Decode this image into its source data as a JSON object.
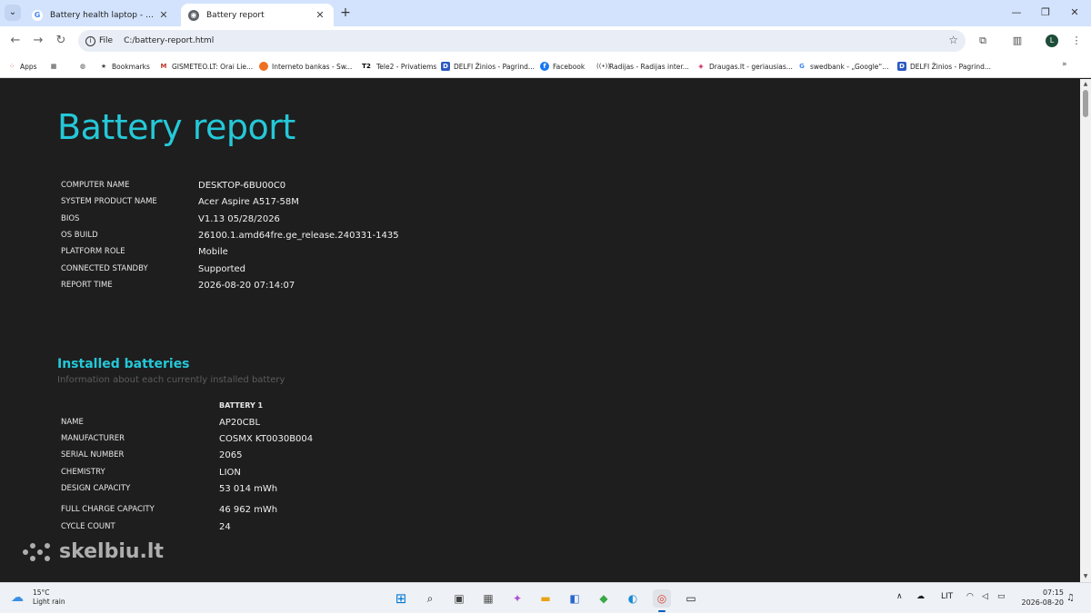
{
  "browser": {
    "tabs": [
      {
        "title": "Battery health laptop - „Google“ p",
        "favicon": "google-icon"
      },
      {
        "title": "Battery report",
        "favicon": "globe-icon"
      }
    ],
    "address": {
      "chip": "File",
      "url": "C:/battery-report.html"
    },
    "profile_initial": "L",
    "bookmarks": [
      {
        "label": "Apps",
        "icon": "apps-grid-icon"
      },
      {
        "label": "",
        "icon": "tab-groups-icon"
      },
      {
        "label": "",
        "icon": "globe-icon"
      },
      {
        "label": "Bookmarks",
        "icon": "star-icon"
      },
      {
        "label": "GISMETEO.LT: Orai Lie...",
        "icon": "gismeteo-icon"
      },
      {
        "label": "Interneto bankas - Sw...",
        "icon": "swedbank-icon"
      },
      {
        "label": "Tele2 - Privatiems",
        "icon": "tele2-icon"
      },
      {
        "label": "DELFI Žinios - Pagrind...",
        "icon": "delfi-icon"
      },
      {
        "label": "Facebook",
        "icon": "facebook-icon"
      },
      {
        "label": "Radijas - Radijas inter...",
        "icon": "radio-icon"
      },
      {
        "label": "Draugas.lt - geriausias...",
        "icon": "draugas-icon"
      },
      {
        "label": "swedbank - „Google“...",
        "icon": "google-icon"
      },
      {
        "label": "DELFI Žinios - Pagrind...",
        "icon": "delfi-icon"
      }
    ]
  },
  "report": {
    "title": "Battery report",
    "system_info": [
      {
        "label": "COMPUTER NAME",
        "value": "DESKTOP-6BU00C0"
      },
      {
        "label": "SYSTEM PRODUCT NAME",
        "value": "Acer Aspire A517-58M"
      },
      {
        "label": "BIOS",
        "value": "V1.13 05/28/2026"
      },
      {
        "label": "OS BUILD",
        "value": "26100.1.amd64fre.ge_release.240331-1435"
      },
      {
        "label": "PLATFORM ROLE",
        "value": "Mobile"
      },
      {
        "label": "CONNECTED STANDBY",
        "value": "Supported"
      },
      {
        "label": "REPORT TIME",
        "value": "2026-08-20   07:14:07"
      }
    ],
    "installed_batteries": {
      "title": "Installed batteries",
      "subtitle": "Information about each currently installed battery",
      "column_header": "BATTERY 1",
      "rows": [
        {
          "label": "NAME",
          "value": "AP20CBL"
        },
        {
          "label": "MANUFACTURER",
          "value": "COSMX KT0030B004"
        },
        {
          "label": "SERIAL NUMBER",
          "value": "2065"
        },
        {
          "label": "CHEMISTRY",
          "value": "LION"
        },
        {
          "label": "DESIGN CAPACITY",
          "value": "53 014 mWh"
        },
        {
          "label": "FULL CHARGE CAPACITY",
          "value": "46 962 mWh"
        },
        {
          "label": "CYCLE COUNT",
          "value": "24"
        }
      ]
    }
  },
  "watermark": "skelbiu.lt",
  "taskbar": {
    "weather_temp": "15°C",
    "weather_desc": "Light rain",
    "language": "LIT",
    "time": "07:15",
    "date": "2026-08-20"
  },
  "colors": {
    "accent": "#25c8d8",
    "page_bg": "#1e1e1e",
    "tab_strip": "#d3e3fd"
  }
}
